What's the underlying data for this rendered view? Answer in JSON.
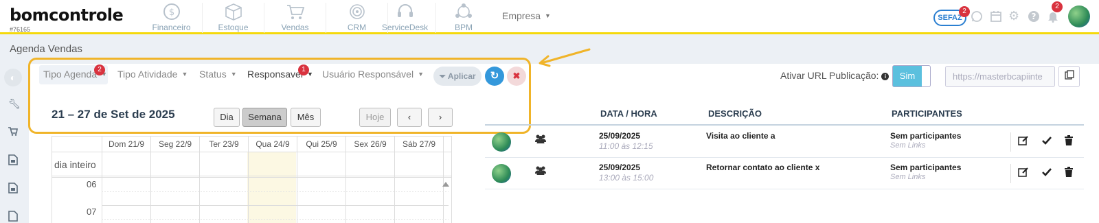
{
  "header": {
    "logo": "bomcontrole",
    "account_id": "#76165",
    "modules": [
      {
        "label": "Financeiro",
        "icon": "dollar-icon"
      },
      {
        "label": "Estoque",
        "icon": "box-icon"
      },
      {
        "label": "Vendas",
        "icon": "cart-icon"
      },
      {
        "label": "CRM",
        "icon": "target-icon"
      },
      {
        "label": "ServiceDesk",
        "icon": "headset-icon"
      },
      {
        "label": "BPM",
        "icon": "network-icon"
      }
    ],
    "empresa_label": "Empresa",
    "sefaz_label": "SEFAZ",
    "sefaz_badge": "2",
    "notifications_badge": "2"
  },
  "page": {
    "title": "Agenda Vendas"
  },
  "filters": {
    "tipo_agenda": "Tipo Agenda",
    "tipo_agenda_badge": "2",
    "tipo_atividade": "Tipo Atividade",
    "status": "Status",
    "responsavel": "Responsavel",
    "responsavel_badge": "1",
    "usuario_responsavel": "Usuário Responsável",
    "apply_label": "Aplicar"
  },
  "publication": {
    "label": "Ativar URL Publicação:",
    "toggle_label": "Sim",
    "url_value": "https://masterbcapiinte"
  },
  "calendar": {
    "title": "21 – 27 de Set de 2025",
    "views": [
      "Dia",
      "Semana",
      "Mês"
    ],
    "active_view": "Semana",
    "today_label": "Hoje",
    "days": [
      "Dom 21/9",
      "Seg 22/9",
      "Ter 23/9",
      "Qua 24/9",
      "Qui 25/9",
      "Sex 26/9",
      "Sáb 27/9"
    ],
    "all_day_label": "dia inteiro",
    "hours": [
      "06",
      "07"
    ]
  },
  "events": {
    "columns": [
      "DATA / HORA",
      "DESCRIÇÃO",
      "PARTICIPANTES"
    ],
    "rows": [
      {
        "date": "25/09/2025",
        "time": "11:00 às 12:15",
        "description": "Visita ao cliente a",
        "participants": "Sem participantes",
        "links": "Sem Links"
      },
      {
        "date": "25/09/2025",
        "time": "13:00 às 15:00",
        "description": "Retornar contato ao cliente x",
        "participants": "Sem participantes",
        "links": "Sem Links"
      }
    ]
  },
  "colors": {
    "accent": "#3498db",
    "highlight": "#f0b429",
    "topbar_border": "#f5d90a",
    "badge": "#d9333f",
    "today": "#fcf8e3"
  }
}
